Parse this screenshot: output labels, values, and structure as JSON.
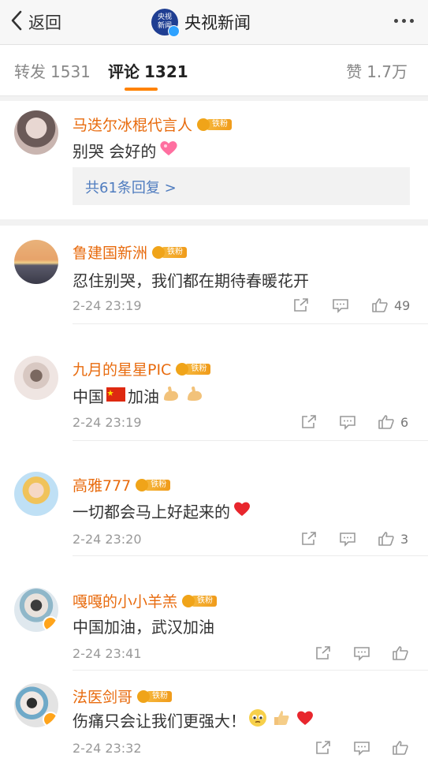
{
  "nav": {
    "back_label": "返回",
    "title": "央视新闻",
    "logo_text_line1": "央视",
    "logo_text_line2": "新闻"
  },
  "tabs": [
    {
      "label": "转发",
      "count": "1531"
    },
    {
      "label": "评论",
      "count": "1321"
    },
    {
      "label": "赞",
      "count": "1.7万"
    }
  ],
  "fan_badge": "铁粉",
  "comments": [
    {
      "name": "马迭尔冰棍代言人",
      "text": "别哭 会好的",
      "reply_link": "共61条回复 >"
    },
    {
      "name": "鲁建国新洲",
      "text": "忍住别哭，我们都在期待春暖花开",
      "time": "2-24 23:19",
      "likes": "49"
    },
    {
      "name": "九月的星星PIC",
      "text_a": "中国",
      "text_b": "加油",
      "time": "2-24 23:19",
      "likes": "6"
    },
    {
      "name": "高雅777",
      "text": "一切都会马上好起来的",
      "time": "2-24 23:20",
      "likes": "3"
    },
    {
      "name": "嘎嘎的小小羊羔",
      "text": "中国加油，武汉加油",
      "time": "2-24 23:41",
      "likes": ""
    },
    {
      "name": "法医剑哥",
      "text": "伤痛只会让我们更强大！",
      "time": "2-24 23:32",
      "likes": ""
    }
  ],
  "colors": {
    "accent": "#ff8200",
    "username": "#e86b0e",
    "link": "#4f7cbf"
  }
}
